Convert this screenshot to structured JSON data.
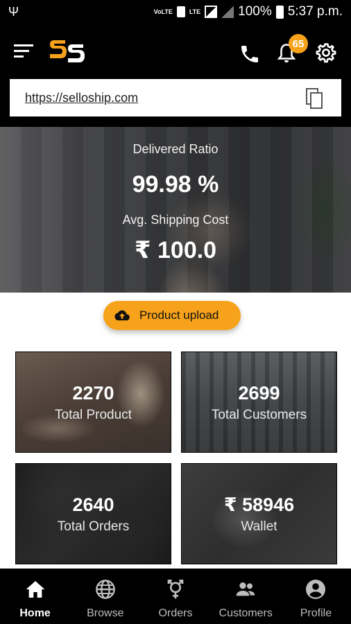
{
  "status_bar": {
    "voice_lte_label": "VoLTE",
    "lte_label": "LTE",
    "battery": "100%",
    "time": "5:37 p.m."
  },
  "app_bar": {
    "notification_count": "65"
  },
  "url_box": {
    "url": "https://selloship.com"
  },
  "hero": {
    "delivered_ratio_label": "Delivered Ratio",
    "delivered_ratio_value": "99.98 %",
    "avg_shipping_label": "Avg. Shipping Cost",
    "avg_shipping_value": "₹ 100.0"
  },
  "upload_button": {
    "label": "Product upload"
  },
  "tiles": [
    {
      "value": "2270",
      "caption": "Total Product"
    },
    {
      "value": "2699",
      "caption": "Total Customers"
    },
    {
      "value": "2640",
      "caption": "Total Orders"
    },
    {
      "value": "₹ 58946",
      "caption": "Wallet"
    }
  ],
  "bottom_nav": [
    {
      "label": "Home",
      "icon": "home-icon",
      "active": true
    },
    {
      "label": "Browse",
      "icon": "globe-icon",
      "active": false
    },
    {
      "label": "Orders",
      "icon": "gender-icon",
      "active": false
    },
    {
      "label": "Customers",
      "icon": "people-icon",
      "active": false
    },
    {
      "label": "Profile",
      "icon": "account-circle-icon",
      "active": false
    }
  ],
  "colors": {
    "accent": "#f7a21b",
    "background": "#000000"
  }
}
